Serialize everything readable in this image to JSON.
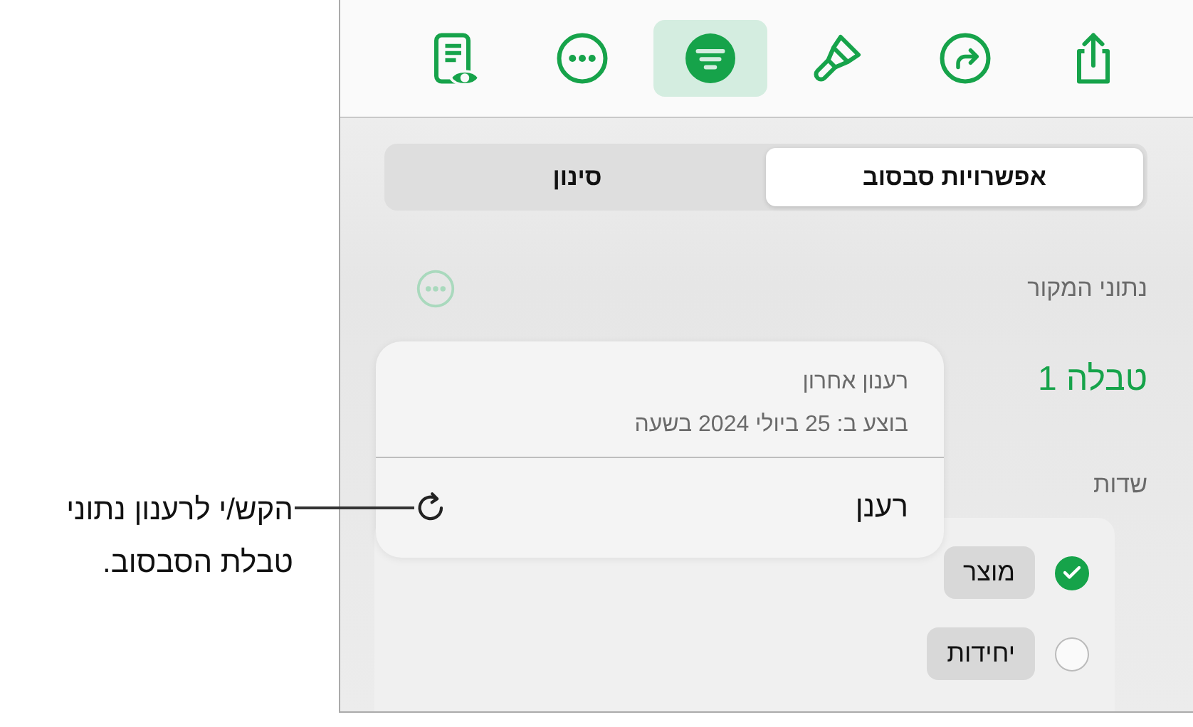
{
  "toolbar": [
    {
      "kind": "preview",
      "selected": false
    },
    {
      "kind": "more",
      "selected": false
    },
    {
      "kind": "filter",
      "selected": true
    },
    {
      "kind": "brush",
      "selected": false
    },
    {
      "kind": "redo",
      "selected": false
    },
    {
      "kind": "share",
      "selected": false
    }
  ],
  "segments": [
    {
      "label": "אפשרויות סבסוב",
      "selected": true
    },
    {
      "label": "סינון",
      "selected": false
    }
  ],
  "source": {
    "label": "נתוני המקור",
    "value": "טבלה 1"
  },
  "popover": {
    "title": "רענון אחרון",
    "subtitle": "בוצע ב: 25 ביולי 2024 בשעה",
    "action": "רענן"
  },
  "fields": {
    "label": "שדות",
    "items": [
      {
        "name": "מוצר",
        "checked": true
      },
      {
        "name": "יחידות",
        "checked": false
      }
    ]
  },
  "callout": {
    "text": "הקש/י לרענון נתוני טבלת הסבסוב."
  }
}
